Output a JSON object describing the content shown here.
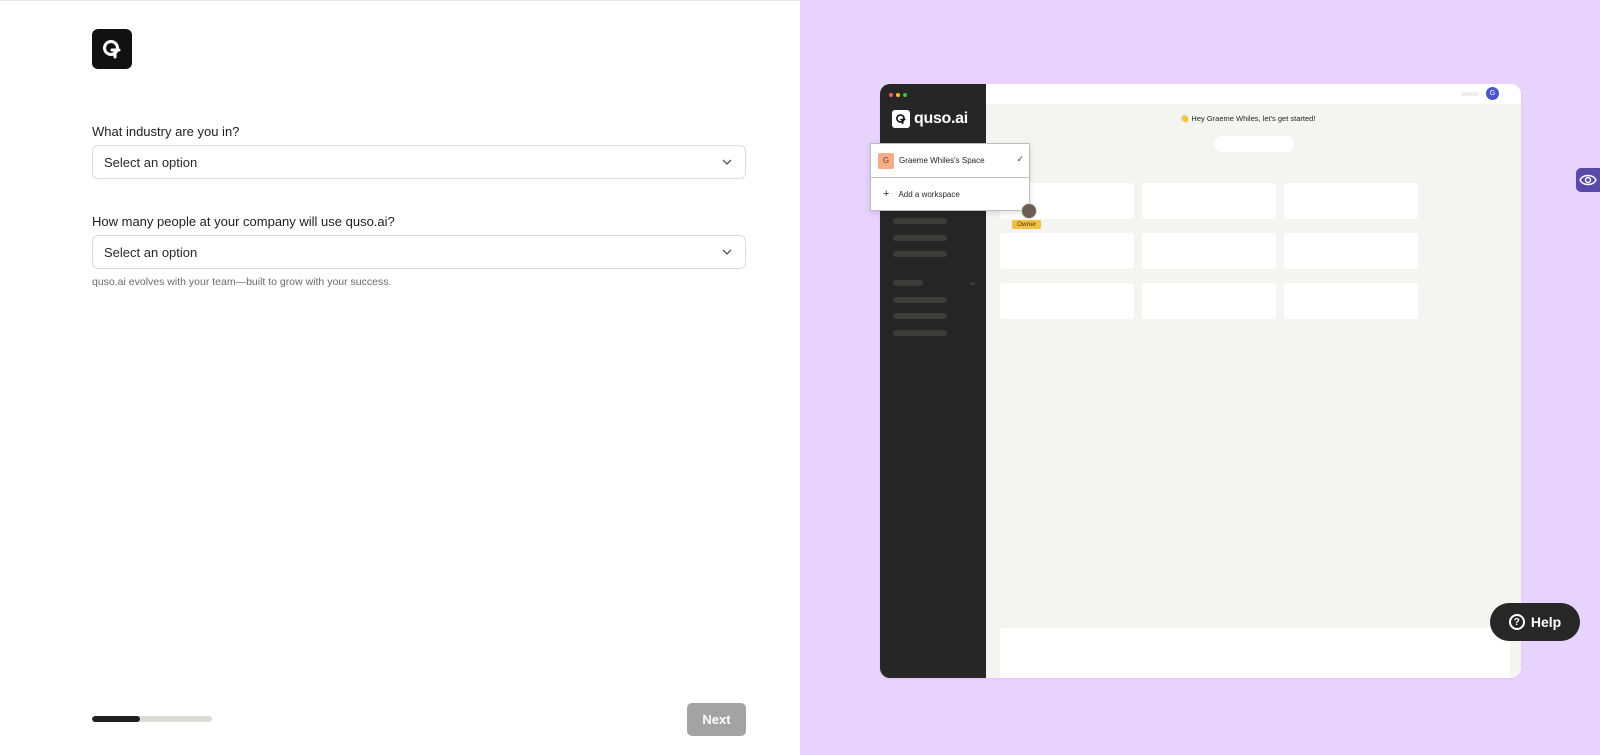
{
  "form": {
    "industry_label": "What industry are you in?",
    "industry_value": "Select an option",
    "team_size_label": "How many people at your company will use quso.ai?",
    "team_size_value": "Select an option",
    "hint": "quso.ai evolves with your team—built to grow with your success."
  },
  "footer": {
    "progress_fraction": 0.4,
    "next_label": "Next"
  },
  "preview": {
    "brand": "quso.ai",
    "greeting": "👋 Hey Graeme Whiles, let's get started!",
    "avatar_initial": "G",
    "workspace_initial": "G",
    "workspace_name": "Graeme Whiles's Space",
    "add_workspace": "Add a workspace",
    "owner_badge": "Owner"
  },
  "help": {
    "label": "Help",
    "glyph": "?"
  },
  "colors": {
    "right_panel_bg": "#e8d2fe",
    "next_disabled": "#a3a3a3",
    "avatar": "#4b55c9",
    "owner_badge": "#f4c044"
  },
  "icons": [
    "app-logo-icon",
    "chevron-down-icon",
    "check-icon",
    "plus-icon",
    "help-icon",
    "accessibility-icon"
  ]
}
